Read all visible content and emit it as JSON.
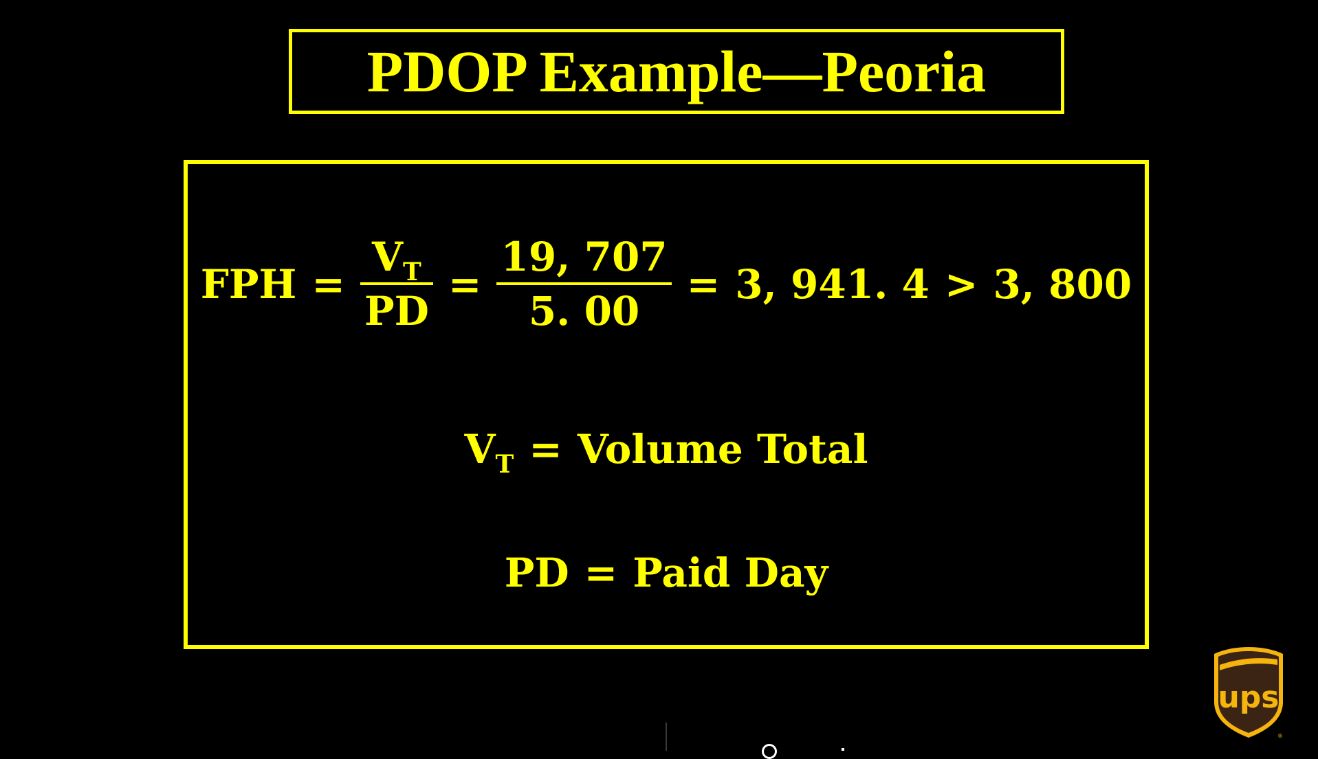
{
  "slide": {
    "title": "PDOP Example—Peoria",
    "formula": {
      "lhs": "FPH",
      "eq": "=",
      "frac1": {
        "num_base": "V",
        "num_sub": "T",
        "den": "PD"
      },
      "frac2": {
        "num": "19, 707",
        "den": "5. 00"
      },
      "result": "3, 941. 4",
      "gt": ">",
      "threshold": "3, 800"
    },
    "definitions": [
      {
        "base": "V",
        "sub": "T",
        "eq": "=",
        "meaning": "Volume Total"
      },
      {
        "base": "PD",
        "sub": "",
        "eq": "=",
        "meaning": "Paid Day"
      }
    ]
  },
  "logo": {
    "name": "ups-logo",
    "text": "ups",
    "colors": {
      "shield": "#3B2413",
      "gold": "#F6B40E"
    }
  },
  "colors": {
    "background": "#000000",
    "accent": "#FFFF00"
  }
}
